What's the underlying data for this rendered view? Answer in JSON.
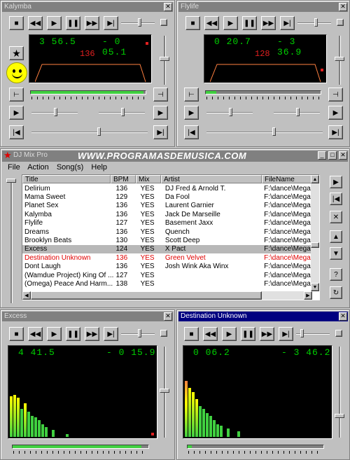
{
  "deck_a": {
    "title": "Kalymba",
    "time_elapsed": "3 56.5",
    "time_remaining": "- 0 05.1",
    "bpm": "136",
    "progress": 0.98
  },
  "deck_b": {
    "title": "Flylife",
    "time_elapsed": "0 20.7",
    "time_remaining": "- 3 36.9",
    "bpm": "128",
    "progress": 0.09
  },
  "deck_c": {
    "title": "Excess",
    "time_elapsed": "4 41.5",
    "time_remaining": "- 0 15.9",
    "progress": 0.95
  },
  "deck_d": {
    "title": "Destination Unknown",
    "time_elapsed": "0 06.2",
    "time_remaining": "- 3 46.2",
    "progress": 0.03
  },
  "banner": "WWW.PROGRAMASDEMUSICA.COM",
  "app": {
    "title": "DJ Mix Pro",
    "menu": [
      "File",
      "Action",
      "Song(s)",
      "Help"
    ],
    "columns": [
      "Title",
      "BPM",
      "Mix",
      "Artist",
      "FileName"
    ],
    "rows": [
      {
        "title": "Delirium",
        "bpm": "136",
        "mix": "YES",
        "artist": "DJ Fred & Arnold T.",
        "file": "F:\\dance\\Mega"
      },
      {
        "title": "Mama Sweet",
        "bpm": "129",
        "mix": "YES",
        "artist": "Da Fool",
        "file": "F:\\dance\\Mega"
      },
      {
        "title": "Planet Sex",
        "bpm": "136",
        "mix": "YES",
        "artist": "Laurent Garnier",
        "file": "F:\\dance\\Mega"
      },
      {
        "title": "Kalymba",
        "bpm": "136",
        "mix": "YES",
        "artist": "Jack De Marseille",
        "file": "F:\\dance\\Mega"
      },
      {
        "title": "Flylife",
        "bpm": "127",
        "mix": "YES",
        "artist": "Basement Jaxx",
        "file": "F:\\dance\\Mega"
      },
      {
        "title": "Dreams",
        "bpm": "136",
        "mix": "YES",
        "artist": "Quench",
        "file": "F:\\dance\\Mega"
      },
      {
        "title": "Brooklyn Beats",
        "bpm": "130",
        "mix": "YES",
        "artist": "Scott Deep",
        "file": "F:\\dance\\Mega"
      },
      {
        "title": "Excess",
        "bpm": "124",
        "mix": "YES",
        "artist": "X Pact",
        "file": "F:\\dance\\Mega"
      },
      {
        "title": "Destination Unknown",
        "bpm": "136",
        "mix": "YES",
        "artist": "Green Velvet",
        "file": "F:\\dance\\Mega"
      },
      {
        "title": "Dont Laugh",
        "bpm": "136",
        "mix": "YES",
        "artist": "Josh Wink Aka Winx",
        "file": "F:\\dance\\Mega"
      },
      {
        "title": "(Wamdue Project) King Of ...",
        "bpm": "127",
        "mix": "YES",
        "artist": "",
        "file": "F:\\dance\\Mega"
      },
      {
        "title": "(Omega) Peace And Harm...",
        "bpm": "138",
        "mix": "YES",
        "artist": "",
        "file": "F:\\dance\\Mega"
      }
    ]
  },
  "colors": {
    "lcd_green": "#00d000",
    "lcd_red": "#e02020",
    "title_active": "#000080",
    "selected_row": "#b8b8b8"
  }
}
